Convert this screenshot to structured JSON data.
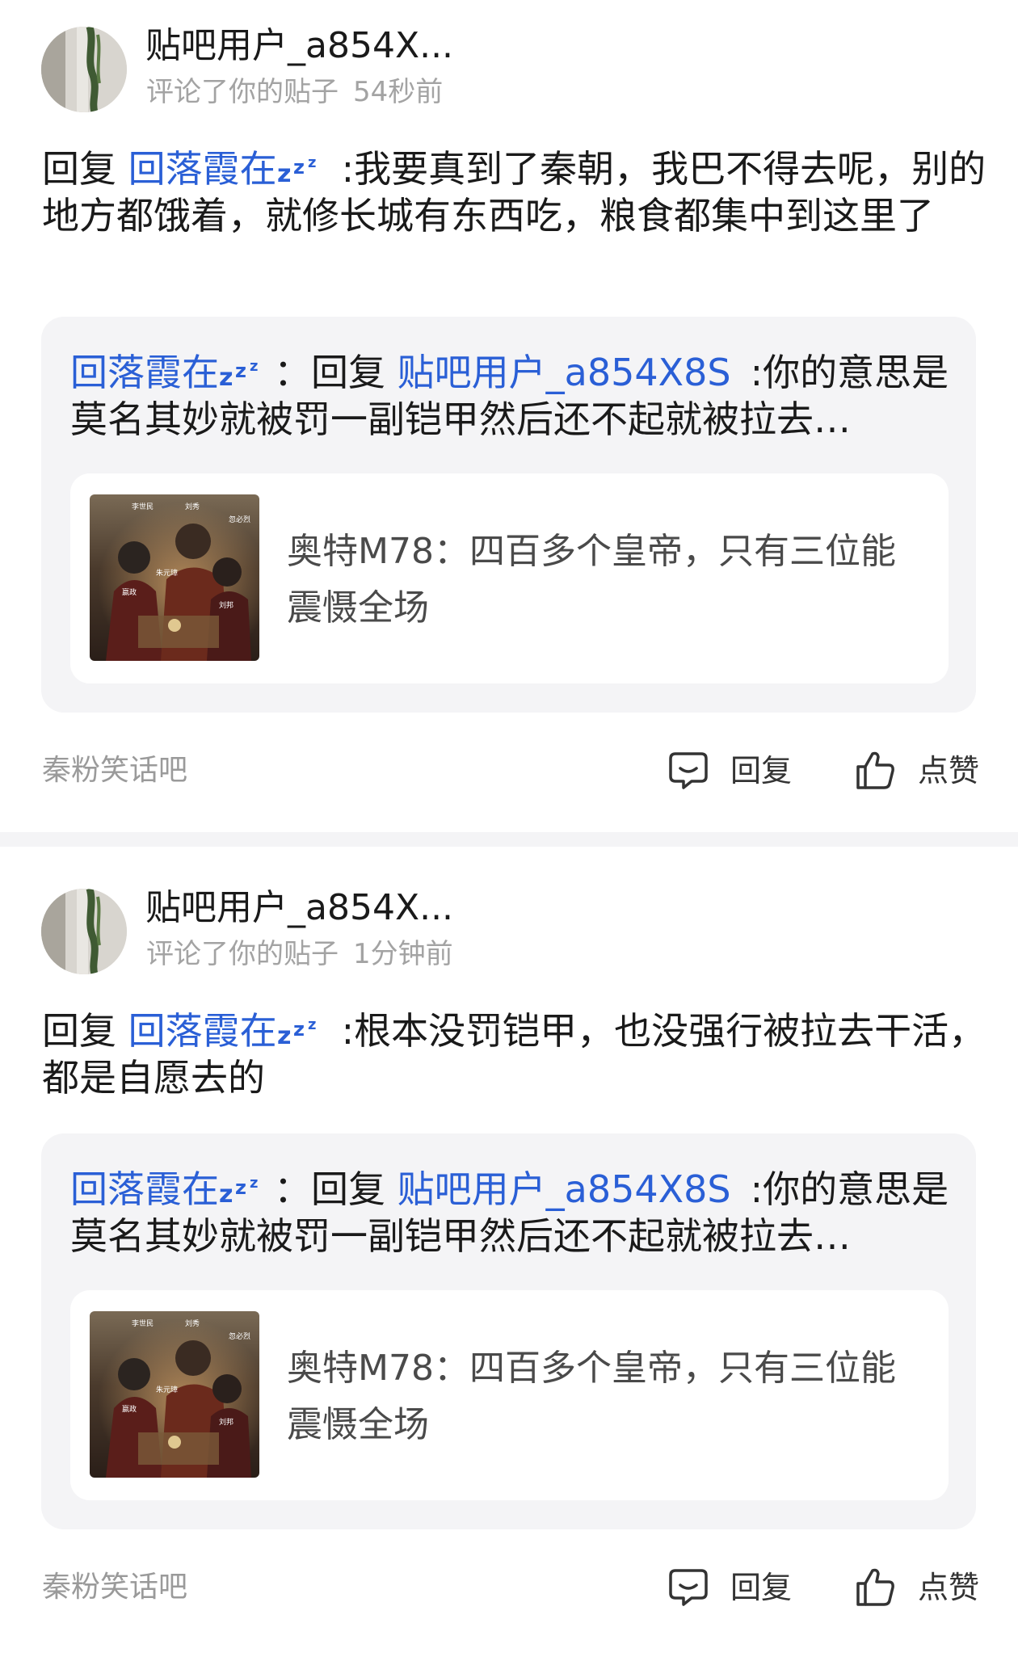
{
  "notifications": [
    {
      "username": "贴吧用户_a854X...",
      "action_text": "评论了你的贴子",
      "time": "54秒前",
      "reply_prefix": "回复 ",
      "reply_to": "回落霞在",
      "reply_body": ":我要真到了秦朝，我巴不得去呢，别的地方都饿着，就修长城有东西吃，粮食都集中到这里了",
      "quote": {
        "author": "回落霞在",
        "sep": "：回复 ",
        "reply_to": "贴吧用户_a854X8S",
        "body": ":你的意思是莫名其妙就被罚一副铠甲然后还不起就被拉去…"
      },
      "original_post": {
        "text": "奥特M78：四百多个皇帝，只有三位能震慑全场",
        "thumbnail_labels": [
          "嬴政",
          "朱元璋",
          "刘邦",
          "刘秀",
          "忽必烈",
          "李世民"
        ]
      },
      "forum": "秦粉笑话吧",
      "reply_button": "回复",
      "like_button": "点赞"
    },
    {
      "username": "贴吧用户_a854X...",
      "action_text": "评论了你的贴子",
      "time": "1分钟前",
      "reply_prefix": "回复 ",
      "reply_to": "回落霞在",
      "reply_body": ":根本没罚铠甲，也没强行被拉去干活，都是自愿去的",
      "quote": {
        "author": "回落霞在",
        "sep": "：回复 ",
        "reply_to": "贴吧用户_a854X8S",
        "body": ":你的意思是莫名其妙就被罚一副铠甲然后还不起就被拉去…"
      },
      "original_post": {
        "text": "奥特M78：四百多个皇帝，只有三位能震慑全场",
        "thumbnail_labels": [
          "嬴政",
          "朱元璋",
          "刘邦",
          "刘秀",
          "忽必烈",
          "李世民"
        ]
      },
      "forum": "秦粉笑话吧",
      "reply_button": "回复",
      "like_button": "点赞"
    }
  ],
  "colors": {
    "link_blue": "#2a5fd6",
    "secondary_gray": "#a3a3a3",
    "quote_background": "#f4f4f6",
    "card_background": "#ffffff"
  },
  "icons": {
    "status_emoji": "zzz-sleep-icon",
    "reply": "comment-bubble-icon",
    "like": "thumbs-up-icon"
  }
}
